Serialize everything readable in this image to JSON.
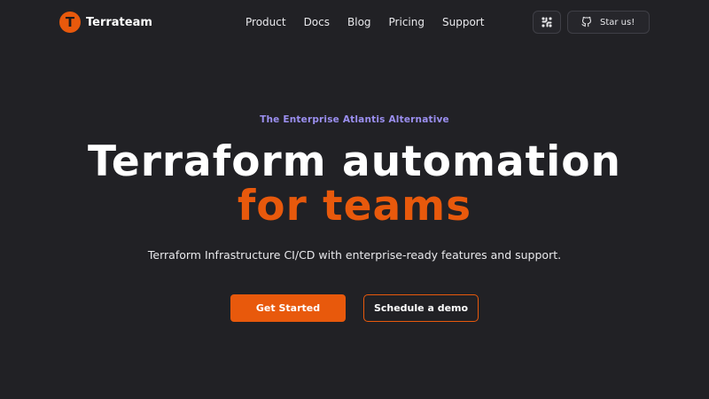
{
  "brand": {
    "logo_letter": "T",
    "name": "Terrateam",
    "logo_icon": "terrateam-logo-icon"
  },
  "nav": {
    "links": [
      "Product",
      "Docs",
      "Blog",
      "Pricing",
      "Support"
    ]
  },
  "social": {
    "slack_icon": "slack-icon",
    "github_icon": "github-icon",
    "github_label": "Star us!"
  },
  "hero": {
    "eyebrow": "The Enterprise Atlantis Alternative",
    "headline_line1": "Terraform automation",
    "headline_line2": "for teams",
    "subtitle": "Terraform Infrastructure CI/CD with enterprise-ready features and support.",
    "primary_cta": "Get Started",
    "secondary_cta": "Schedule a demo"
  },
  "colors": {
    "background": "#212125",
    "accent": "#e8590c",
    "eyebrow": "#9b8ff0",
    "text": "#ffffff"
  }
}
